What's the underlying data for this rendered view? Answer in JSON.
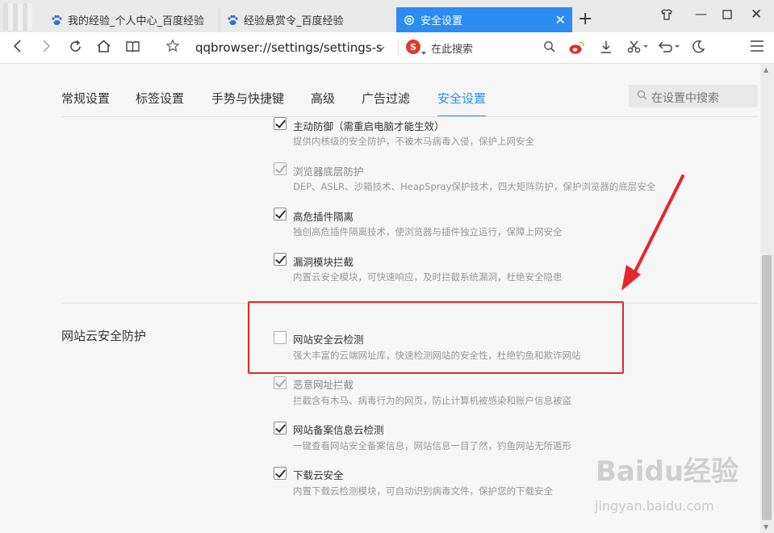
{
  "browser": {
    "tabs": [
      {
        "title": "我的经验_个人中心_百度经验",
        "active": false
      },
      {
        "title": "经验悬赏令_百度经验",
        "active": false
      },
      {
        "title": "安全设置",
        "active": true
      }
    ],
    "new_tab": "+",
    "url": "qqbrowser://settings/settings-s",
    "search_placeholder": "在此搜索"
  },
  "settings": {
    "tabs": [
      "常规设置",
      "标签设置",
      "手势与快捷键",
      "高级",
      "广告过滤",
      "安全设置"
    ],
    "active_tab": "安全设置",
    "search_placeholder": "在设置中搜索",
    "section_title": "网站云安全防护",
    "options": [
      {
        "label": "主动防御（需重启电脑才能生效）",
        "desc": "提供内核级的安全防护，不被木马病毒入侵，保护上网安全",
        "checked": true,
        "disabled": false
      },
      {
        "label": "浏览器底层防护",
        "desc": "DEP、ASLR、沙箱技术、HeapSpray保护技术，四大矩阵防护，保护浏览器的底层安全",
        "checked": true,
        "disabled": true
      },
      {
        "label": "高危插件隔离",
        "desc": "独创高危插件隔离技术，使浏览器与插件独立运行，保障上网安全",
        "checked": true,
        "disabled": false
      },
      {
        "label": "漏洞模块拦截",
        "desc": "内置云安全模块，可快速响应，及时拦截系统漏洞，杜绝安全隐患",
        "checked": true,
        "disabled": false
      },
      {
        "label": "网站安全云检测",
        "desc": "强大丰富的云端网址库，快速检测网站的安全性，杜绝钓鱼和欺诈网站",
        "checked": false,
        "disabled": false
      },
      {
        "label": "恶意网址拦截",
        "desc": "拦截含有木马、病毒行为的网页，防止计算机被感染和账户信息被盗",
        "checked": true,
        "disabled": true
      },
      {
        "label": "网站备案信息云检测",
        "desc": "一键查看网站安全备案信息，网站信息一目了然，钓鱼网站无所遁形",
        "checked": true,
        "disabled": false
      },
      {
        "label": "下载云安全",
        "desc": "内置下载云检测模块，可自动识别病毒文件，保护您的下载安全",
        "checked": true,
        "disabled": false
      }
    ]
  },
  "watermark": {
    "logo": "Baidu经验",
    "sub": "jingyan.baidu.com"
  },
  "colors": {
    "accent": "#2b8cf4",
    "highlight": "#e6262c",
    "arrow": "#e6262c"
  }
}
